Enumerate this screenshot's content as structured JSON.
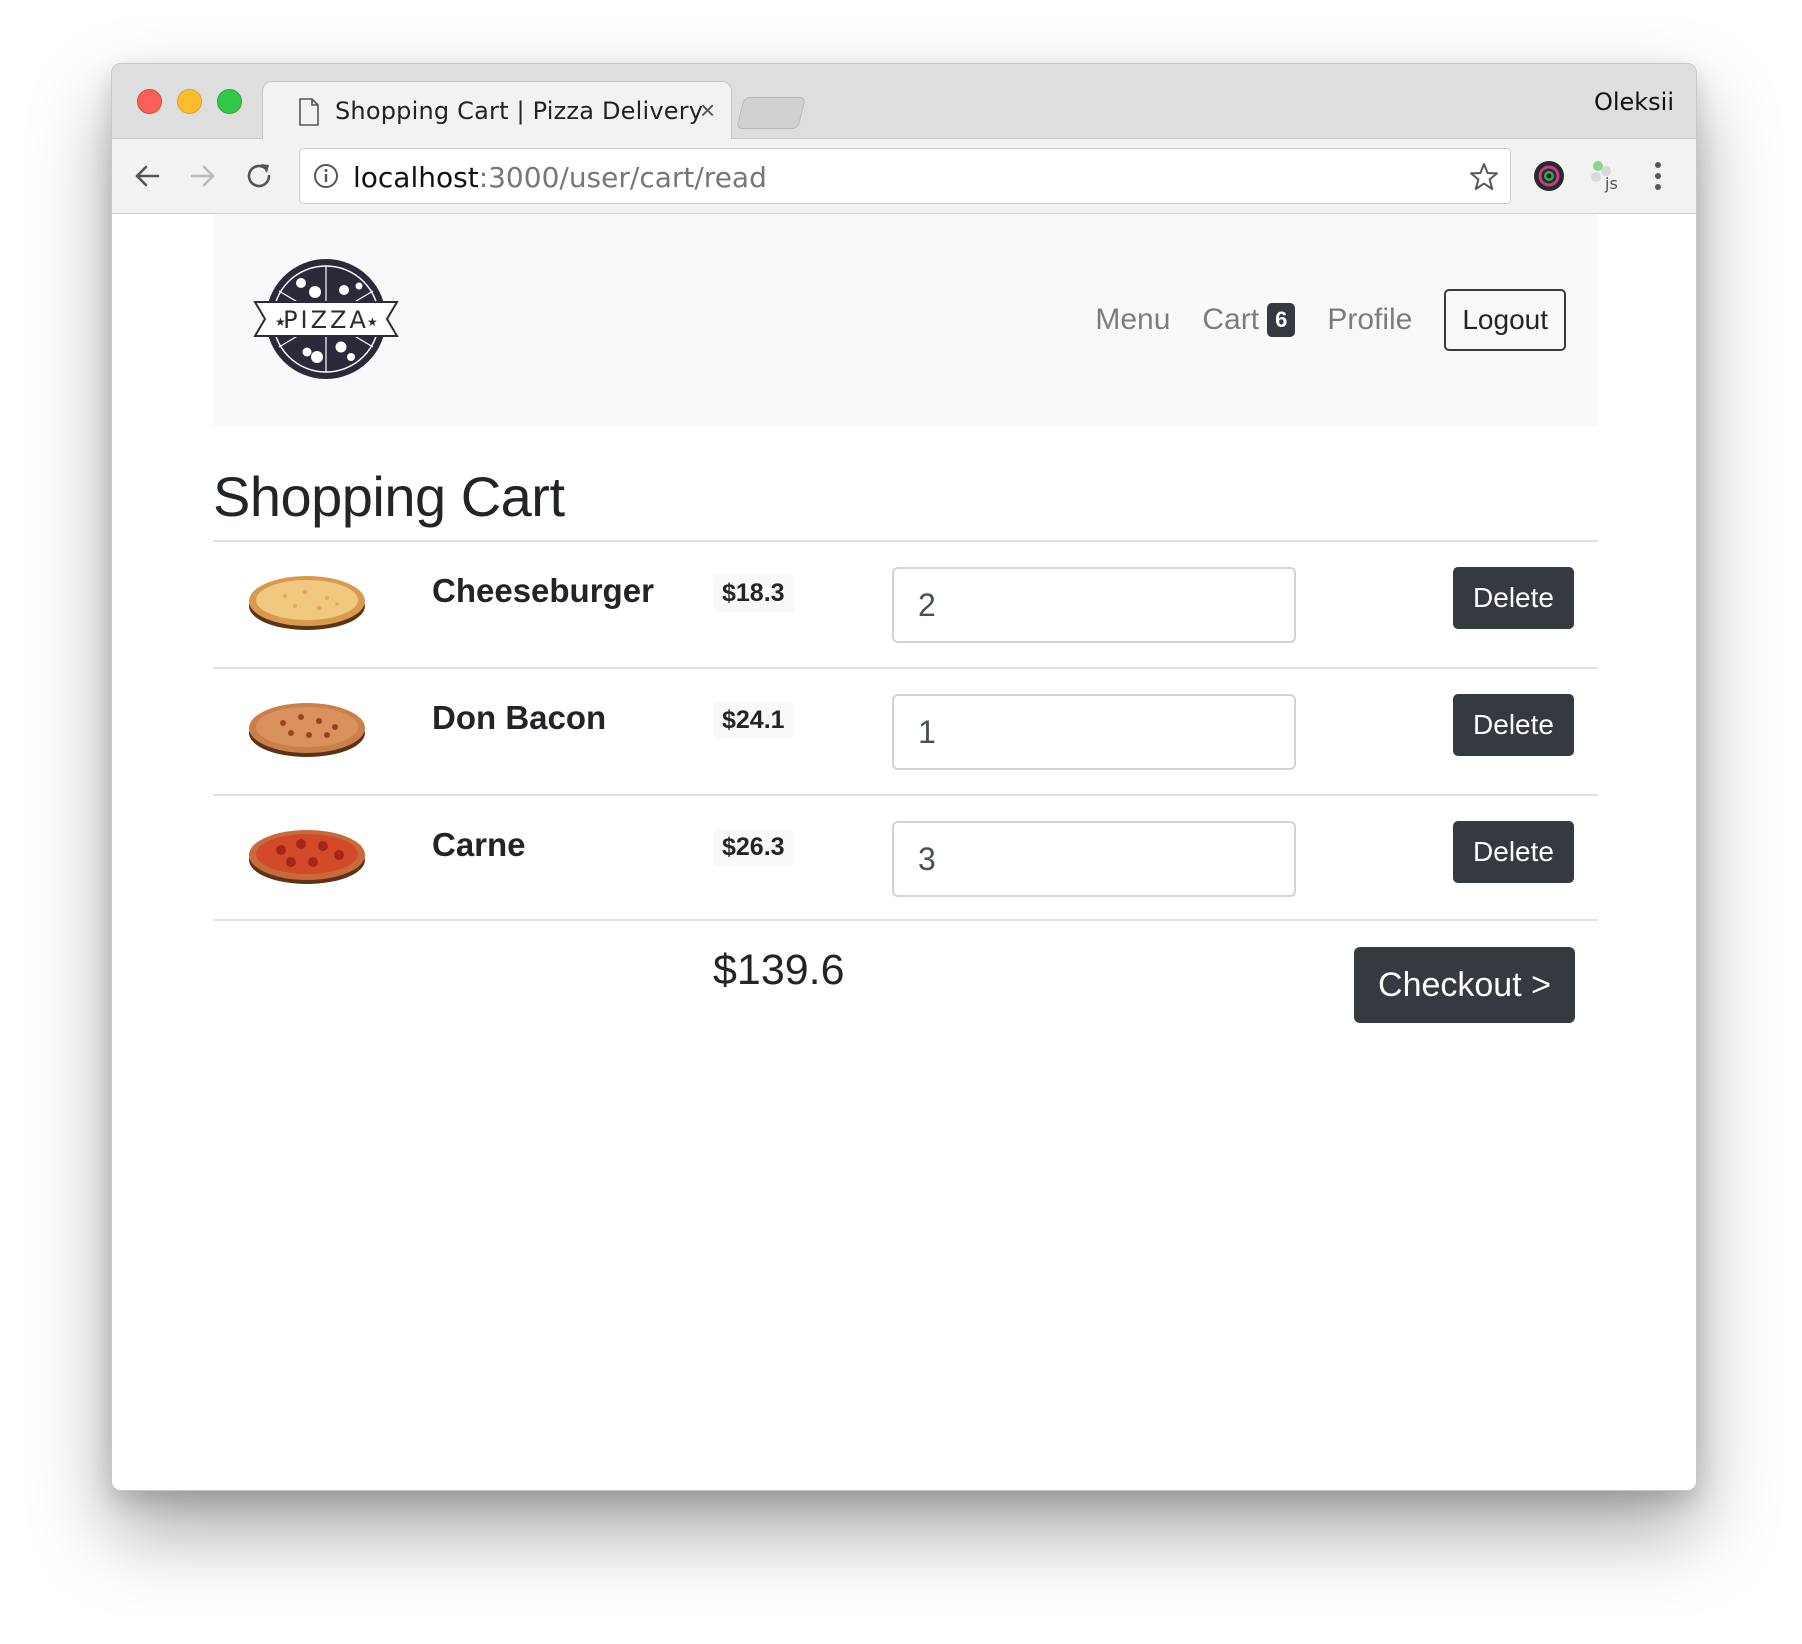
{
  "browser": {
    "tab_title": "Shopping Cart | Pizza Delivery",
    "tab_close": "×",
    "profile_name": "Oleksii",
    "url_host": "localhost",
    "url_path": ":3000/user/cart/read"
  },
  "navbar": {
    "logo_text": "PIZZA",
    "links": {
      "menu": "Menu",
      "cart": "Cart",
      "cart_count": "6",
      "profile": "Profile",
      "logout": "Logout"
    }
  },
  "cart": {
    "title": "Shopping Cart",
    "items": [
      {
        "name": "Cheeseburger",
        "price": "$18.3",
        "quantity": "2",
        "delete_label": "Delete",
        "image": "cheese-pizza"
      },
      {
        "name": "Don Bacon",
        "price": "$24.1",
        "quantity": "1",
        "delete_label": "Delete",
        "image": "bacon-pizza"
      },
      {
        "name": "Carne",
        "price": "$26.3",
        "quantity": "3",
        "delete_label": "Delete",
        "image": "pepperoni-pizza"
      }
    ],
    "total": "$139.6",
    "checkout_label": "Checkout >"
  },
  "colors": {
    "dark_button": "#343a40",
    "navbar_bg": "#f8f9fa"
  }
}
